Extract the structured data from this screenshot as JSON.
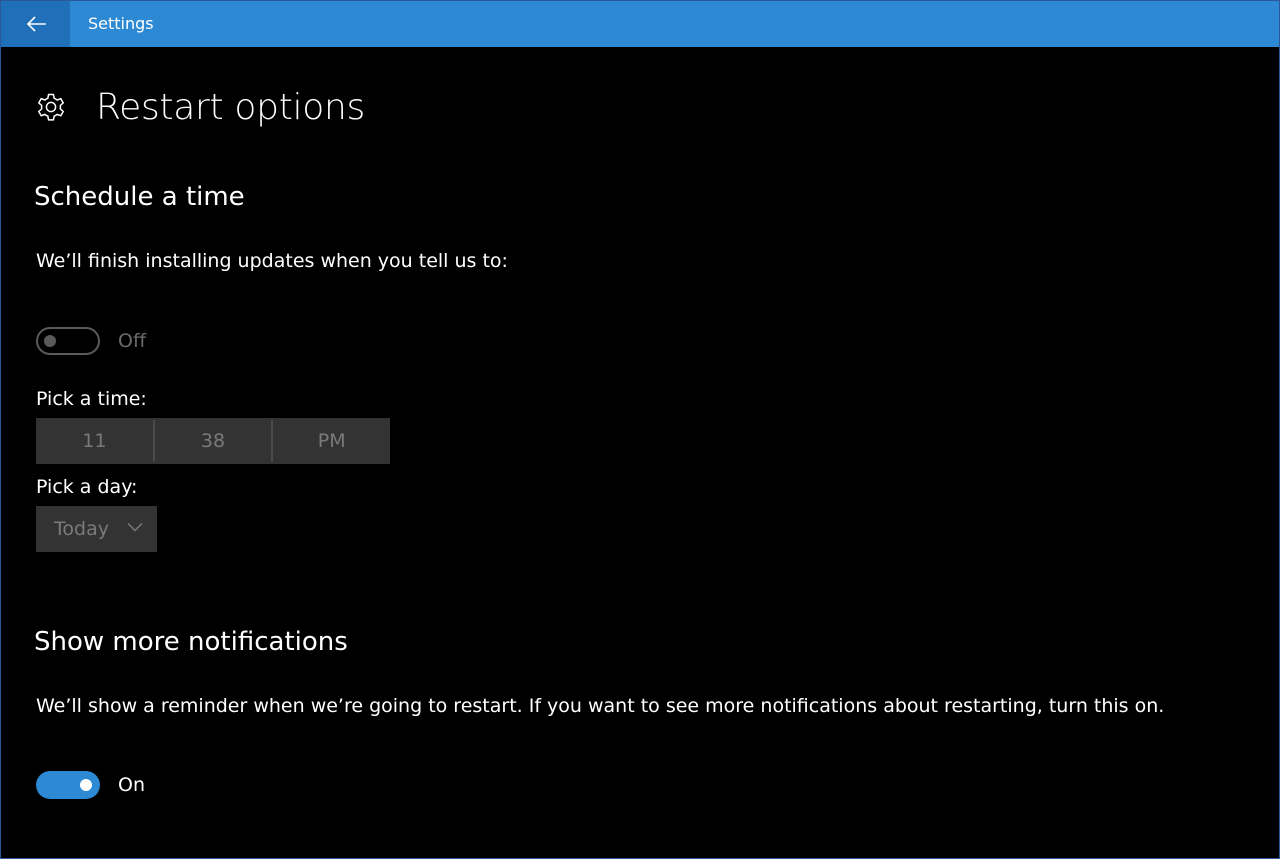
{
  "app": {
    "title": "Settings"
  },
  "page": {
    "title": "Restart options"
  },
  "schedule": {
    "heading": "Schedule a time",
    "description": "We’ll finish installing updates when you tell us to:",
    "toggle_state": "Off",
    "pick_time_label": "Pick a time:",
    "time": {
      "hour": "11",
      "minute": "38",
      "period": "PM"
    },
    "pick_day_label": "Pick a day:",
    "day_value": "Today"
  },
  "notifications": {
    "heading": "Show more notifications",
    "description": "We’ll show a reminder when we’re going to restart. If you want to see more notifications about restarting, turn this on.",
    "toggle_state": "On"
  },
  "colors": {
    "accent": "#2d89d4",
    "back_button": "#1f6fb9",
    "background": "#000000",
    "control_disabled": "#333333"
  },
  "icons": {
    "back": "arrow-left-icon",
    "page": "gear-icon",
    "dropdown": "chevron-down-icon"
  }
}
